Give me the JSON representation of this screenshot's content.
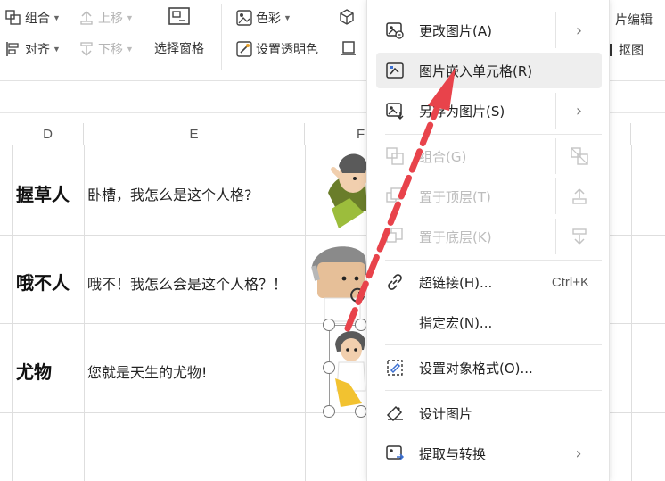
{
  "ribbon": {
    "group_label": "组合",
    "move_up_label": "上移",
    "align_label": "对齐",
    "move_down_label": "下移",
    "selection_pane_label": "选择窗格",
    "color_label": "色彩",
    "set_transparent_label": "设置透明色",
    "right_top_label": "片编辑",
    "right_bottom_label": "抠图"
  },
  "sheet": {
    "columns": [
      "D",
      "E",
      "F"
    ],
    "rows": [
      {
        "d": "握草人",
        "e": "卧槽，我怎么是这个人格?"
      },
      {
        "d": "哦不人",
        "e": "哦不！我怎么会是这个人格？！"
      },
      {
        "d": "尤物",
        "e": "您就是天生的尤物!"
      }
    ]
  },
  "context_menu": {
    "items": [
      {
        "label": "更改图片(A)"
      },
      {
        "label": "图片嵌入单元格(R)"
      },
      {
        "label": "另存为图片(S)"
      },
      {
        "label": "组合(G)"
      },
      {
        "label": "置于顶层(T)"
      },
      {
        "label": "置于底层(K)"
      },
      {
        "label": "超链接(H)...",
        "shortcut": "Ctrl+K"
      },
      {
        "label": "指定宏(N)..."
      },
      {
        "label": "设置对象格式(O)..."
      },
      {
        "label": "设计图片"
      },
      {
        "label": "提取与转换"
      }
    ]
  },
  "colors": {
    "arrow": "#e8434b",
    "highlight": "#eeeeee",
    "disabled_text": "#bdbdbd"
  }
}
